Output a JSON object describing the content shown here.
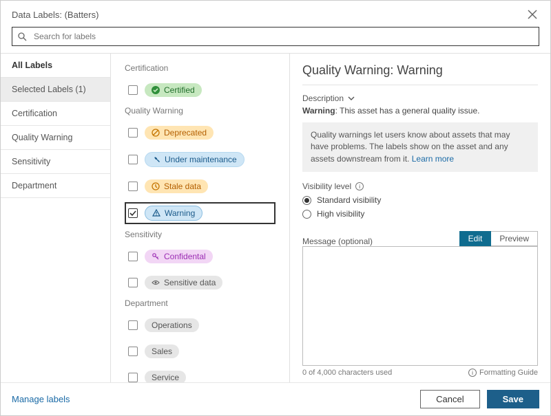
{
  "header": {
    "title": "Data Labels: (Batters)"
  },
  "search": {
    "placeholder": "Search for labels"
  },
  "sidebar": {
    "all": "All Labels",
    "selected": "Selected Labels (1)",
    "items": [
      "Certification",
      "Quality Warning",
      "Sensitivity",
      "Department"
    ]
  },
  "groups": {
    "certification": {
      "title": "Certification",
      "items": [
        {
          "label": "Certified"
        }
      ]
    },
    "quality": {
      "title": "Quality Warning",
      "items": [
        {
          "label": "Deprecated"
        },
        {
          "label": "Under maintenance"
        },
        {
          "label": "Stale data"
        },
        {
          "label": "Warning"
        }
      ]
    },
    "sensitivity": {
      "title": "Sensitivity",
      "items": [
        {
          "label": "Confidental"
        },
        {
          "label": "Sensitive data"
        }
      ]
    },
    "department": {
      "title": "Department",
      "items": [
        {
          "label": "Operations"
        },
        {
          "label": "Sales"
        },
        {
          "label": "Service"
        }
      ]
    }
  },
  "details": {
    "title": "Quality Warning: Warning",
    "descHead": "Description",
    "descBoldLabel": "Warning",
    "descText": ": This asset has a general quality issue.",
    "infoText": "Quality warnings let users know about assets that may have problems. The labels show on the asset and any assets downstream from it. ",
    "learnMore": "Learn more",
    "visLabel": "Visibility level",
    "radios": {
      "standard": "Standard visibility",
      "high": "High visibility"
    },
    "msgLabel": "Message (optional)",
    "tabs": {
      "edit": "Edit",
      "preview": "Preview"
    },
    "counter": "0 of 4,000 characters used",
    "formattingGuide": "Formatting Guide"
  },
  "footer": {
    "manage": "Manage labels",
    "cancel": "Cancel",
    "save": "Save"
  }
}
